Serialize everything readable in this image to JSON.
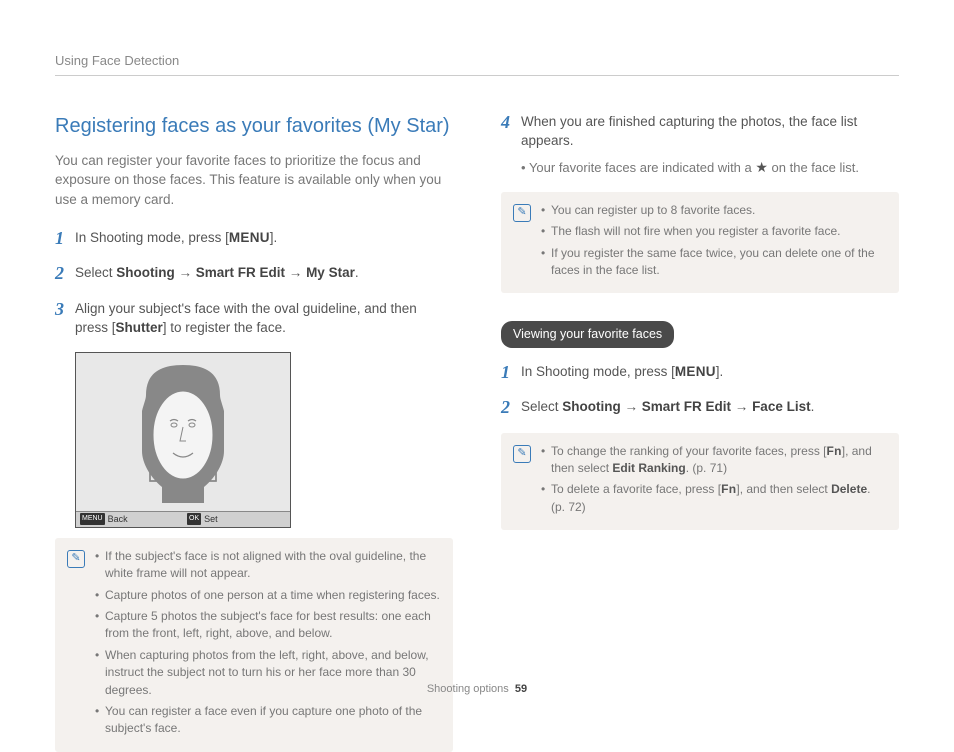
{
  "header": "Using Face Detection",
  "title": "Registering faces as your favorites (My Star)",
  "intro": "You can register your favorite faces to prioritize the focus and exposure on those faces. This feature is available only when you use a memory card.",
  "steps_a": {
    "s1_a": "In Shooting mode, press [",
    "s1_menu": "MENU",
    "s1_b": "].",
    "s2_a": "Select ",
    "s2_b1": "Shooting",
    "s2_arr1": " → ",
    "s2_b2": "Smart FR Edit",
    "s2_arr2": " → ",
    "s2_b3": "My Star",
    "s2_end": ".",
    "s3_a": "Align your subject's face with the oval guideline, and then press [",
    "s3_b": "Shutter",
    "s3_c": "] to register the face."
  },
  "camera_bar": {
    "back_tag": "MENU",
    "back": "Back",
    "set_tag": "OK",
    "set": "Set"
  },
  "note1": [
    "If the subject's face is not aligned with the oval guideline, the white frame will not appear.",
    "Capture photos of one person at a time when registering faces.",
    "Capture 5 photos the subject's face for best results: one each from the front, left, right, above, and below.",
    "When capturing photos from the left, right, above, and below, instruct the subject not to turn his or her face more than 30 degrees.",
    "You can register a face even if you capture one photo of the subject's face."
  ],
  "step4": {
    "a": "When you are finished capturing the photos, the face list appears.",
    "sub_a": "Your favorite faces are indicated with a ",
    "sub_b": " on the face list."
  },
  "note2": [
    "You can register up to 8 favorite faces.",
    "The flash will not fire when you register a favorite face.",
    "If you register the same face twice, you can delete one of the faces in the face list."
  ],
  "pill": "Viewing your favorite faces",
  "steps_b": {
    "s1_a": "In Shooting mode, press [",
    "s1_menu": "MENU",
    "s1_b": "].",
    "s2_a": "Select ",
    "s2_b1": "Shooting",
    "s2_arr1": " → ",
    "s2_b2": "Smart FR Edit",
    "s2_arr2": " → ",
    "s2_b3": "Face List",
    "s2_end": "."
  },
  "note3": {
    "li1_a": "To change the ranking of your favorite faces, press [",
    "li1_fn": "Fn",
    "li1_b": "], and then select ",
    "li1_bold": "Edit Ranking",
    "li1_c": ". (p. 71)",
    "li2_a": "To delete a favorite face, press [",
    "li2_fn": "Fn",
    "li2_b": "], and then select ",
    "li2_bold": "Delete",
    "li2_c": ". (p. 72)"
  },
  "footer": {
    "section": "Shooting options",
    "page": "59"
  }
}
